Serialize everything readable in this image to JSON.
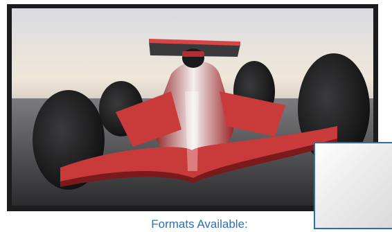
{
  "image": {
    "subject": "race-car-photo"
  },
  "caption": {
    "text": "Formats Available:"
  },
  "swatch": {
    "material": "matte-silver-swatch"
  },
  "colors": {
    "frame": "#1c1c1c",
    "caption": "#2f6fb2",
    "swatch_border": "#2a6db5",
    "car_body": "#c93a3a"
  }
}
